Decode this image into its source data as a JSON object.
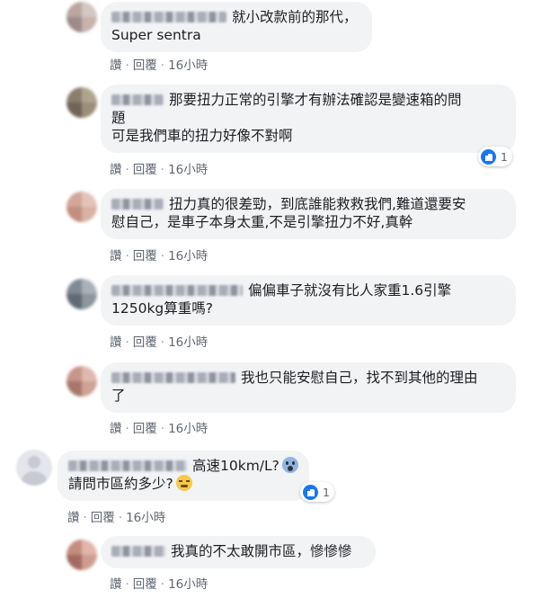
{
  "actions": {
    "like": "讚",
    "reply": "回覆",
    "separator": "·"
  },
  "comments": [
    {
      "lines": [
        "就小改款前的那代，",
        "Super sentra"
      ],
      "time": "16小時",
      "reactions": ""
    },
    {
      "lines": [
        "那要扭力正常的引擎才有辦法確認是變速箱的問",
        "題",
        "可是我們車的扭力好像不對啊"
      ],
      "time": "16小時",
      "reactions": "1"
    },
    {
      "lines": [
        "扭力真的很差勁，到底誰能救救我們,難道還要安",
        "慰自己，是車子本身太重,不是引擎扭力不好,真幹"
      ],
      "time": "16小時",
      "reactions": ""
    },
    {
      "lines": [
        "偏偏車子就沒有比人家重1.6引擎",
        "1250kg算重嗎?"
      ],
      "time": "16小時",
      "reactions": ""
    },
    {
      "lines": [
        "我也只能安慰自己，找不到其他的理由",
        "了"
      ],
      "time": "16小時",
      "reactions": ""
    },
    {
      "lines": [
        "高速10km/L?",
        "請問市區約多少?"
      ],
      "time": "16小時",
      "reactions": "1"
    },
    {
      "lines": [
        "我真的不太敢開市區，慘慘慘"
      ],
      "time": "16小時",
      "reactions": ""
    }
  ],
  "icons": {
    "like_reaction": "like-icon",
    "emoji_1": "screaming-face-icon",
    "emoji_2": "tired-face-icon"
  },
  "colors": {
    "bubble": "#f2f3f5",
    "like_blue": "#1877f2",
    "meta_text": "#606770"
  }
}
